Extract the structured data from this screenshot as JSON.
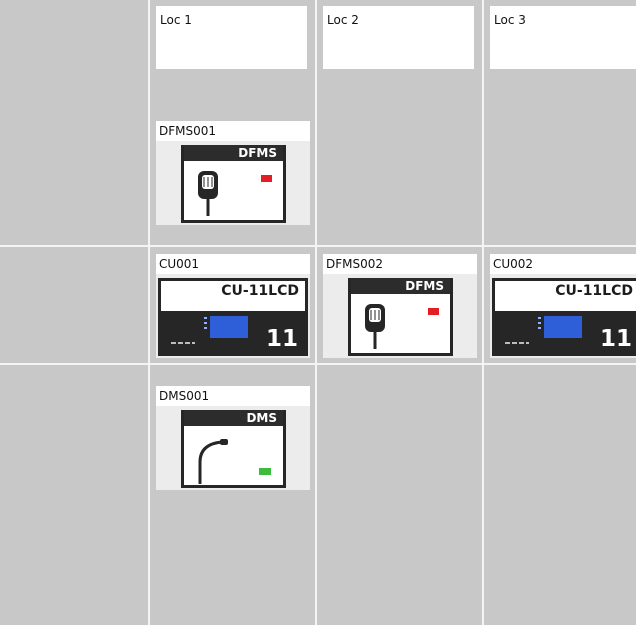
{
  "locations": [
    {
      "label": "Loc 1"
    },
    {
      "label": "Loc 2"
    },
    {
      "label": "Loc 3"
    }
  ],
  "devices": {
    "dfms001": {
      "id": "DFMS001",
      "type_label": "DFMS",
      "indicator_color": "#e31e24",
      "icon": "handheld-microphone-icon"
    },
    "cu001": {
      "id": "CU001",
      "model_label": "CU-11LCD",
      "unit_number": "11",
      "icon": "control-unit-icon"
    },
    "dfms002": {
      "id": "DFMS002",
      "type_label": "DFMS",
      "indicator_color": "#e31e24",
      "icon": "handheld-microphone-icon"
    },
    "cu002": {
      "id": "CU002",
      "model_label": "CU-11LCD",
      "unit_number": "11",
      "icon": "control-unit-icon"
    },
    "dms001": {
      "id": "DMS001",
      "type_label": "DMS",
      "indicator_color": "#3dbb3d",
      "icon": "gooseneck-microphone-icon"
    }
  },
  "colors": {
    "background": "#c8c8c8",
    "grid_lines": "#f4f4f4",
    "device_dark": "#262626",
    "lcd_blue": "#2f5fd8",
    "status_red": "#e31e24",
    "status_green": "#3dbb3d"
  }
}
